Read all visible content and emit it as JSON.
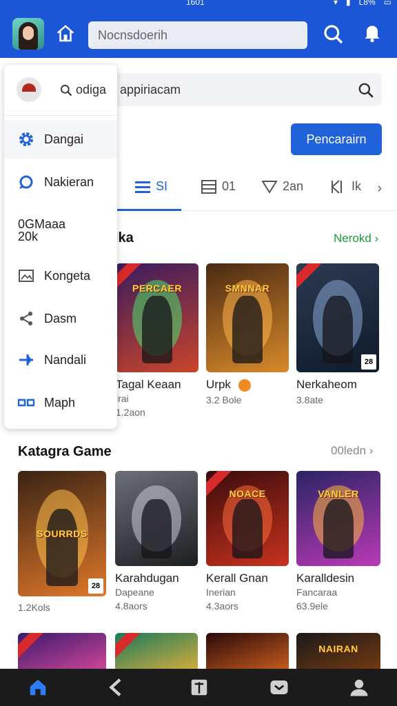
{
  "status_bar": {
    "time": "1601",
    "battery": "L8%"
  },
  "app_bar": {
    "search_placeholder": "Nocnsdoerih",
    "icons": [
      "home-icon",
      "search-icon",
      "notification-icon"
    ]
  },
  "secondary_search": {
    "text": "appiriacam"
  },
  "cta": {
    "label": "Pencarairn"
  },
  "tabs": [
    {
      "label": "SI",
      "icon": "list-icon",
      "active": true
    },
    {
      "label": "01",
      "icon": "grid-icon",
      "active": false
    },
    {
      "label": "2an",
      "icon": "filter-icon",
      "active": false
    },
    {
      "label": "Ik",
      "icon": "bookmark-icon",
      "active": false
    }
  ],
  "menu": {
    "search_label": "odiga",
    "items": [
      {
        "label": "Dangai",
        "icon": "gear-icon",
        "color": "#1f62d9"
      },
      {
        "label": "Nakieran",
        "icon": "chat-icon",
        "color": "#1f62d9"
      },
      {
        "label": "0GMaaa",
        "label2": "20k",
        "icon": "none"
      },
      {
        "label": "Kongeta",
        "icon": "image-icon",
        "color": "#555555"
      },
      {
        "label": "Dasm",
        "icon": "share-icon",
        "color": "#555555"
      },
      {
        "label": "Nandali",
        "icon": "plane-icon",
        "color": "#1f62d9"
      },
      {
        "label": "Maph",
        "icon": "map-icon",
        "color": "#1f62d9"
      }
    ]
  },
  "section1": {
    "title": "lka",
    "link": "Nerokd",
    "link_color": "#1a9e3a",
    "cards": [
      {
        "title": "Tagal Keaan",
        "sub": "lrai",
        "meta": "1.2aon",
        "logo": "PERCAER",
        "bg": [
          "#3a1c5e",
          "#c9452b"
        ],
        "burst": "#48e06b",
        "badge": ""
      },
      {
        "title": "Urpk",
        "sub": "",
        "meta": "3.2 Bole",
        "logo": "SMNNAR",
        "bg": [
          "#4a2a14",
          "#d98a2a"
        ],
        "burst": "#ffb347",
        "badge": ""
      },
      {
        "title": "Nerkaheom",
        "sub": "",
        "meta": "3.8ate",
        "logo": "",
        "bg": [
          "#2c3a52",
          "#0f1a2a"
        ],
        "burst": "#89a7d6",
        "badge": "28"
      }
    ]
  },
  "section2": {
    "title": "Katagra Game",
    "link": "00ledn",
    "link_color": "#888888",
    "cards": [
      {
        "title": "",
        "sub": "",
        "meta": "1.2Kols",
        "logo": "SOURRDS",
        "bg": [
          "#3a2314",
          "#e0782a"
        ],
        "burst": "#ffc04a",
        "badge": "28"
      },
      {
        "title": "Karahdugan",
        "sub": "Dapeane",
        "meta": "4.8aors",
        "logo": "",
        "bg": [
          "#6b6f76",
          "#1d1f23"
        ],
        "burst": "#c7ccd4",
        "badge": ""
      },
      {
        "title": "Kerall Gnan",
        "sub": "Inerian",
        "meta": "4.3aors",
        "logo": "NOACE",
        "bg": [
          "#3a0c0c",
          "#c8321e"
        ],
        "burst": "#ff6a3a",
        "badge": ""
      },
      {
        "title": "Karalldesin",
        "sub": "Fancaraa",
        "meta": "63.9ele",
        "logo": "VANLER",
        "bg": [
          "#2b2466",
          "#b93ab5"
        ],
        "burst": "#ffb43a",
        "badge": ""
      }
    ]
  },
  "section3": {
    "cards": [
      {
        "logo": "",
        "bg": [
          "#3a1a6e",
          "#d8489a"
        ]
      },
      {
        "logo": "",
        "bg": [
          "#1a7a5c",
          "#e0b03a"
        ]
      },
      {
        "logo": "",
        "bg": [
          "#2a0a0a",
          "#d0601e"
        ]
      },
      {
        "logo": "NAIRAN",
        "bg": [
          "#1a1a1a",
          "#7a3b10"
        ]
      }
    ]
  },
  "bottom_nav": [
    "home-icon",
    "back-icon",
    "book-icon",
    "message-icon",
    "profile-icon"
  ]
}
